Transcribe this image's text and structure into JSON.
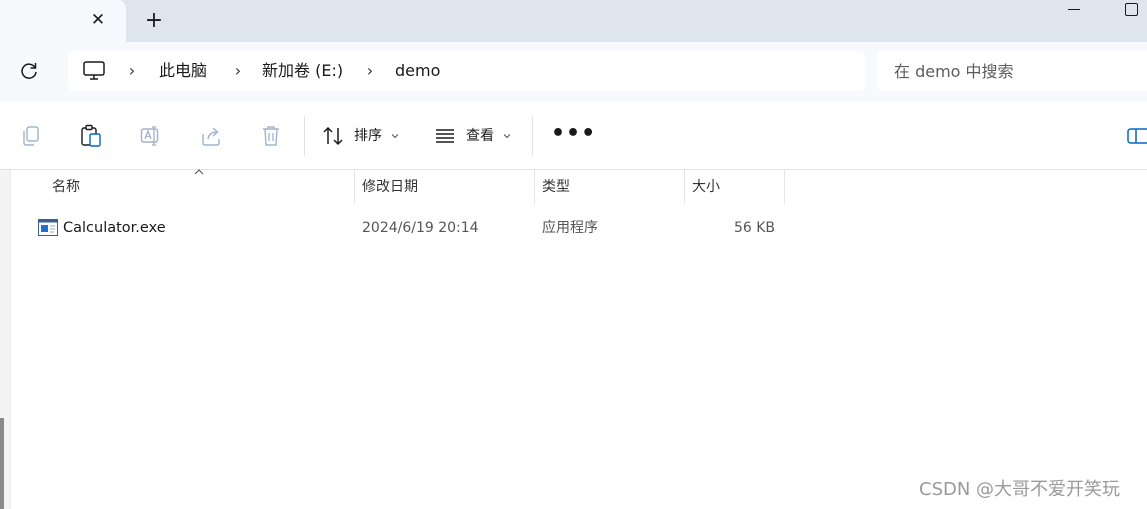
{
  "tab": {
    "close_glyph": "✕",
    "new_glyph": "+"
  },
  "window": {
    "minimize": "minimize-icon",
    "maximize": "maximize-icon"
  },
  "address": {
    "refresh_icon": "refresh-icon",
    "pc_icon": "computer-icon",
    "crumbs": [
      "此电脑",
      "新加卷 (E:)",
      "demo"
    ],
    "separator": "›"
  },
  "search": {
    "placeholder": "在 demo 中搜索"
  },
  "toolbar": {
    "icons": [
      "copy-icon",
      "paste-icon",
      "rename-icon",
      "share-icon",
      "delete-icon"
    ],
    "sort_label": "排序",
    "view_label": "查看",
    "more_label": "•••"
  },
  "columns": [
    "名称",
    "修改日期",
    "类型",
    "大小"
  ],
  "files": [
    {
      "name": "Calculator.exe",
      "modified": "2024/6/19 20:14",
      "type": "应用程序",
      "size": "56 KB",
      "icon": "exe-file-icon"
    }
  ],
  "watermark": "CSDN @大哥不爱开笑玩",
  "colors": {
    "chrome_bg": "#dfe5ee",
    "toolbar_bg": "#f7f9fc",
    "accent": "#0067c0"
  }
}
